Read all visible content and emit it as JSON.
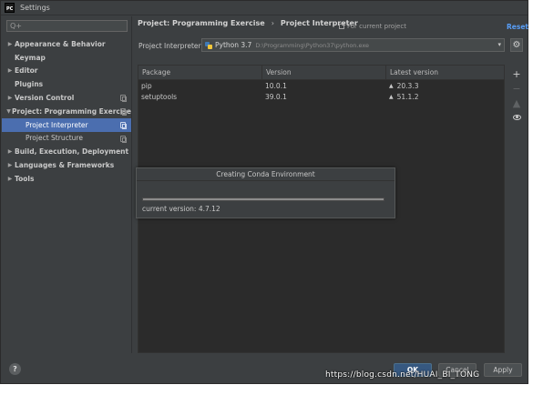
{
  "window": {
    "title": "Settings",
    "app_icon_text": "PC"
  },
  "search": {
    "placeholder": "Q+",
    "value": ""
  },
  "sidebar": {
    "items": [
      {
        "label": "Appearance & Behavior",
        "arrow": "▶",
        "level": 0,
        "bold": true,
        "copy_icon": false,
        "selected": false
      },
      {
        "label": "Keymap",
        "arrow": "",
        "level": 0,
        "bold": true,
        "copy_icon": false,
        "selected": false
      },
      {
        "label": "Editor",
        "arrow": "▶",
        "level": 0,
        "bold": true,
        "copy_icon": false,
        "selected": false
      },
      {
        "label": "Plugins",
        "arrow": "",
        "level": 0,
        "bold": true,
        "copy_icon": false,
        "selected": false
      },
      {
        "label": "Version Control",
        "arrow": "▶",
        "level": 0,
        "bold": true,
        "copy_icon": true,
        "selected": false
      },
      {
        "label": "Project: Programming Exercise",
        "arrow": "▼",
        "level": 0,
        "bold": true,
        "copy_icon": true,
        "selected": false
      },
      {
        "label": "Project Interpreter",
        "arrow": "",
        "level": 1,
        "bold": false,
        "copy_icon": true,
        "selected": true
      },
      {
        "label": "Project Structure",
        "arrow": "",
        "level": 1,
        "bold": false,
        "copy_icon": true,
        "selected": false
      },
      {
        "label": "Build, Execution, Deployment",
        "arrow": "▶",
        "level": 0,
        "bold": true,
        "copy_icon": false,
        "selected": false
      },
      {
        "label": "Languages & Frameworks",
        "arrow": "▶",
        "level": 0,
        "bold": true,
        "copy_icon": false,
        "selected": false
      },
      {
        "label": "Tools",
        "arrow": "▶",
        "level": 0,
        "bold": true,
        "copy_icon": false,
        "selected": false
      }
    ]
  },
  "header": {
    "breadcrumb": [
      "Project: Programming Exercise",
      "Project Interpreter"
    ],
    "separator": "›",
    "for_project": "For current project",
    "reset": "Reset"
  },
  "interpreter": {
    "label": "Project Interpreter:",
    "name": "Python 3.7",
    "path": "D:\\Programming\\Python37\\python.exe"
  },
  "packages": {
    "columns": [
      "Package",
      "Version",
      "Latest version"
    ],
    "rows": [
      {
        "package": "pip",
        "version": "10.0.1",
        "latest": "20.3.3"
      },
      {
        "package": "setuptools",
        "version": "39.0.1",
        "latest": "51.1.2"
      }
    ]
  },
  "tools": {
    "add": "+",
    "remove": "−",
    "upgrade": "▲"
  },
  "modal": {
    "title": "Creating Conda Environment",
    "status": "current version: 4.7.12",
    "progress": 1.0
  },
  "footer": {
    "help": "?",
    "ok": "OK",
    "cancel": "Cancel",
    "apply": "Apply"
  },
  "watermark": "https://blog.csdn.net/HUAI_BI_TONG",
  "colors": {
    "background": "#3c3f41",
    "selection": "#4b6eaf",
    "link": "#589df6",
    "ok_button": "#365880"
  }
}
